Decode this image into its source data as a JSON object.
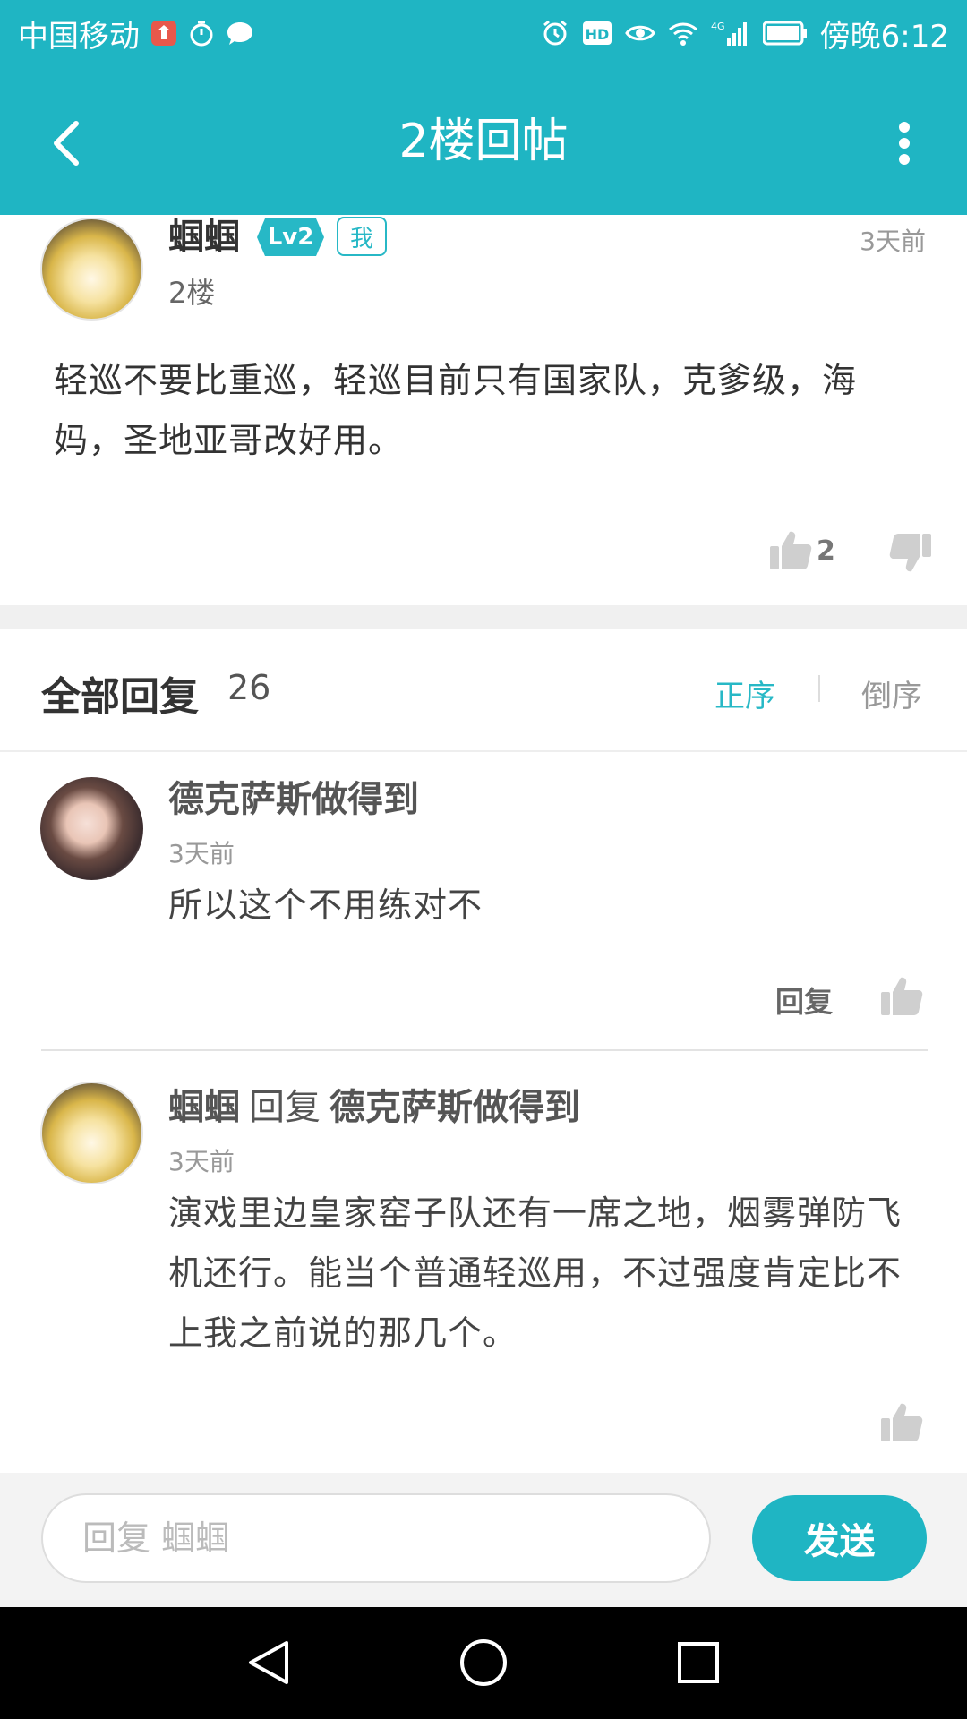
{
  "status_bar": {
    "carrier": "中国移动",
    "time": "傍晚6:12",
    "hd_label": "HD",
    "network_label": "4G",
    "icons": [
      "app-notification-icon",
      "timer-icon",
      "chat-bubble-icon",
      "alarm-icon",
      "hd-icon",
      "eye-icon",
      "wifi-icon",
      "signal-icon",
      "battery-icon"
    ]
  },
  "appbar": {
    "title": "2楼回帖",
    "back_icon": "chevron-left-icon",
    "more_icon": "more-vertical-icon"
  },
  "post": {
    "author": "蝈蝈",
    "level": "Lv2",
    "me_badge": "我",
    "time": "3天前",
    "floor": "2楼",
    "content": "轻巡不要比重巡，轻巡目前只有国家队，克爹级，海妈，圣地亚哥改好用。",
    "like_count": "2"
  },
  "replies_header": {
    "title": "全部回复",
    "count": "26",
    "sort_asc": "正序",
    "sort_desc": "倒序"
  },
  "replies": [
    {
      "author": "德克萨斯做得到",
      "time": "3天前",
      "content": "所以这个不用练对不",
      "reply_label": "回复"
    },
    {
      "author": "蝈蝈",
      "reply_word": "回复",
      "reply_to": "德克萨斯做得到",
      "time": "3天前",
      "content": "演戏里边皇家窑子队还有一席之地，烟雾弹防飞机还行。能当个普通轻巡用，不过强度肯定比不上我之前说的那几个。"
    }
  ],
  "input": {
    "placeholder": "回复 蝈蝈",
    "send_label": "发送"
  },
  "colors": {
    "accent": "#1fb5c3",
    "text_dark": "#333333",
    "text_muted": "#999999",
    "divider": "#f0f0f0"
  }
}
